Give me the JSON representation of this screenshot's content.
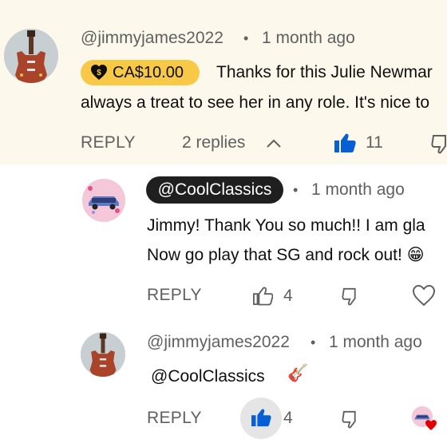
{
  "top_comment": {
    "author": "@jimmyjames2022",
    "time": "1 month ago",
    "super_thanks_amount": "CA$10.00",
    "text_line1": "Thanks for this Julie Newmar",
    "text_line2": "always a treat to see her in any role. It's nice to",
    "reply_label": "REPLY",
    "replies_label": "2 replies",
    "like_count": "11",
    "highlight_color": "#fdf8ec",
    "chip_color": "#f7c946",
    "like_color": "#065fd4"
  },
  "replies": [
    {
      "author": "@CoolClassics",
      "time": "1 month ago",
      "text_line1": "Jimmy!  Thank You so much!!  I am gla",
      "text_line2": "Now go play that SG and rock out! ",
      "emoji": "😁",
      "reply_label": "REPLY",
      "like_count": "4"
    },
    {
      "author": "@jimmyjames2022",
      "time": "1 month ago",
      "mention": "@CoolClassics",
      "emoji": "🎸",
      "reply_label": "REPLY",
      "like_count": "4"
    }
  ],
  "separator": "•"
}
